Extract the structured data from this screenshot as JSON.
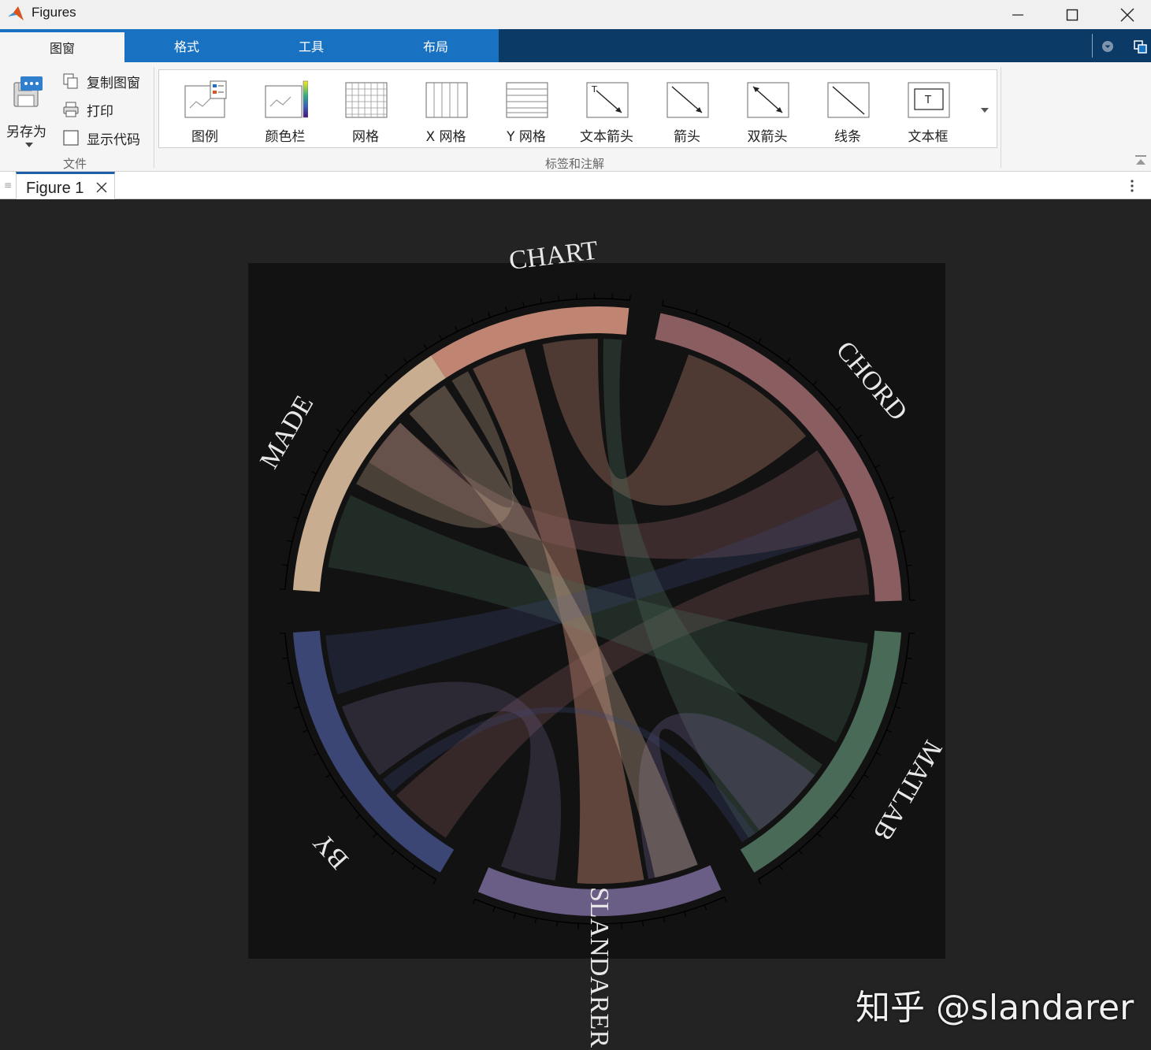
{
  "window": {
    "title": "Figures"
  },
  "ribbon_tabs": [
    {
      "label": "图窗",
      "active": true
    },
    {
      "label": "格式",
      "active": false
    },
    {
      "label": "工具",
      "active": false
    },
    {
      "label": "布局",
      "active": false
    }
  ],
  "file_group": {
    "save_as_label": "另存为",
    "copy_figure_label": "复制图窗",
    "print_label": "打印",
    "show_code_label": "显示代码",
    "show_code_checked": false,
    "group_label": "文件"
  },
  "annotation_group": {
    "group_label": "标签和注解",
    "items": [
      {
        "label": "图例",
        "icon": "legend-icon"
      },
      {
        "label": "颜色栏",
        "icon": "colorbar-icon"
      },
      {
        "label": "网格",
        "icon": "grid-icon"
      },
      {
        "label": "X 网格",
        "icon": "x-grid-icon"
      },
      {
        "label": "Y 网格",
        "icon": "y-grid-icon"
      },
      {
        "label": "文本箭头",
        "icon": "text-arrow-icon"
      },
      {
        "label": "箭头",
        "icon": "arrow-icon"
      },
      {
        "label": "双箭头",
        "icon": "double-arrow-icon"
      },
      {
        "label": "线条",
        "icon": "line-icon"
      },
      {
        "label": "文本框",
        "icon": "textbox-icon"
      }
    ]
  },
  "document_tab": {
    "label": "Figure 1"
  },
  "colors": {
    "ribbon_blue": "#1971c2",
    "ribbon_dark": "#0c3a67",
    "figure_bg": "#232323",
    "axes_bg": "#121212"
  },
  "chart_data": {
    "type": "chord",
    "nodes": [
      {
        "name": "CHART",
        "color": "#c08572"
      },
      {
        "name": "CHORD",
        "color": "#8a5d60"
      },
      {
        "name": "MATLAB",
        "color": "#4a6a58"
      },
      {
        "name": "SLANDARER",
        "color": "#6a5d86"
      },
      {
        "name": "BY",
        "color": "#3b4675"
      },
      {
        "name": "MADE",
        "color": "#c9ad91"
      }
    ]
  },
  "watermark": "知乎 @slandarer"
}
